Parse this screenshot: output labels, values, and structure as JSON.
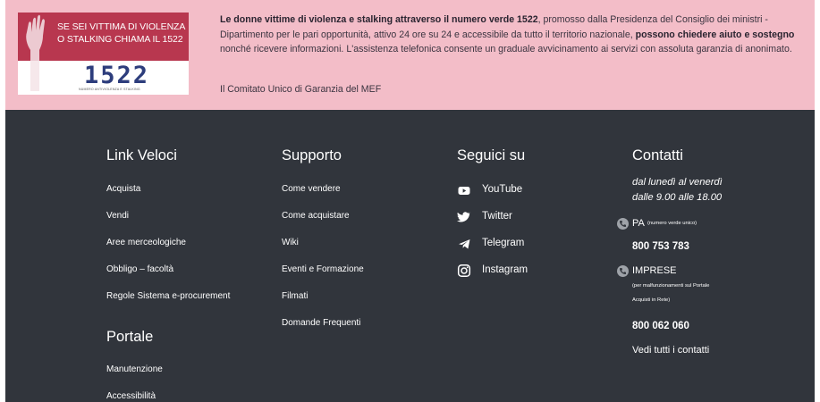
{
  "banner": {
    "logo": {
      "line1": "SE SEI VITTIMA DI VIOLENZA",
      "line2": "O STALKING CHIAMA IL 1522",
      "number": "1522",
      "sub": "NUMERO ANTIVIOLENZA E STALKING"
    },
    "text_bold_1": "Le donne vittime di violenza e stalking attraverso il numero verde 1522",
    "text_1": ", promosso dalla Presidenza del Consiglio dei ministri - Dipartimento per le pari opportunità, attivo 24 ore su 24 e accessibile da tutto il territorio nazionale, ",
    "text_bold_2": "possono chiedere aiuto e sostegno",
    "text_2": " nonché ricevere informazioni. L'assistenza telefonica consente un graduale avvicinamento ai servizi con assoluta garanzia di anonimato.",
    "signature": "Il Comitato Unico di Garanzia del MEF"
  },
  "footer": {
    "link_veloci": {
      "title": "Link Veloci",
      "items": [
        "Acquista",
        "Vendi",
        "Aree merceologiche",
        "Obbligo – facoltà",
        "Regole Sistema e-procurement"
      ]
    },
    "portale": {
      "title": "Portale",
      "items": [
        "Manutenzione",
        "Accessibilità"
      ]
    },
    "supporto": {
      "title": "Supporto",
      "items": [
        "Come vendere",
        "Come acquistare",
        "Wiki",
        "Eventi e Formazione",
        "Filmati",
        "Domande Frequenti"
      ]
    },
    "seguici": {
      "title": "Seguici su",
      "items": [
        {
          "label": "YouTube",
          "icon": "youtube-icon"
        },
        {
          "label": "Twitter",
          "icon": "twitter-icon"
        },
        {
          "label": "Telegram",
          "icon": "telegram-icon"
        },
        {
          "label": "Instagram",
          "icon": "instagram-icon"
        }
      ]
    },
    "contatti": {
      "title": "Contatti",
      "hours_1": "dal lunedì al venerdì",
      "hours_2": "dalle 9.00 alle 18.00",
      "pa_label": "PA",
      "pa_note": "(numero verde unico)",
      "pa_number": "800 753 783",
      "imprese_label": "IMPRESE",
      "imprese_note_1": "(per malfunzionamenti sul Portale",
      "imprese_note_2": "Acquisti in Rete)",
      "imprese_number": "800 062 060",
      "all_contacts": "Vedi tutti i contatti"
    }
  },
  "colors": {
    "banner_bg": "#f3bdc8",
    "footer_bg": "#31353c",
    "logo_red": "#b8374f",
    "logo_blue": "#2d3d7c"
  }
}
